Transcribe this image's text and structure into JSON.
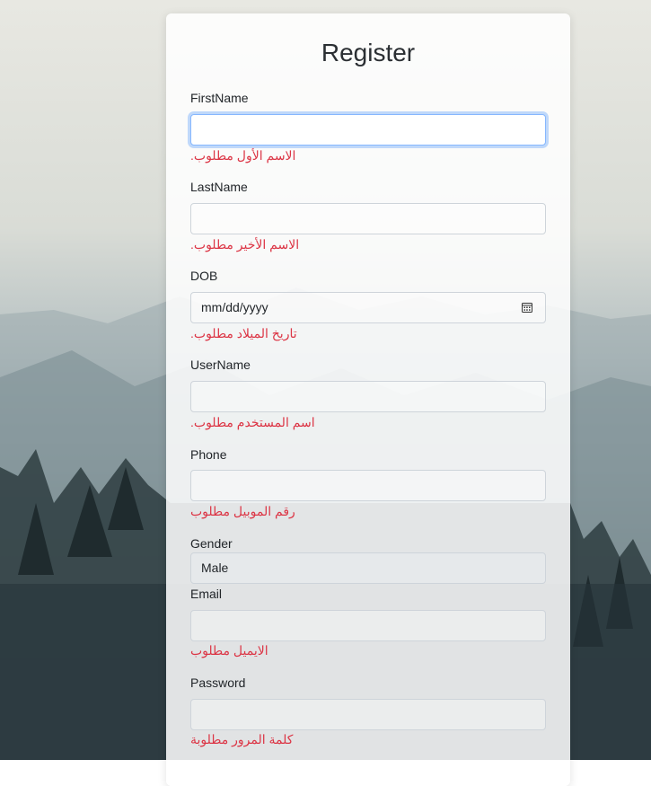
{
  "form": {
    "title": "Register",
    "fields": [
      {
        "label": "FirstName",
        "value": "",
        "error": ".الاسم الأول مطلوب"
      },
      {
        "label": "LastName",
        "value": "",
        "error": ".الاسم الأخير مطلوب"
      },
      {
        "label": "DOB",
        "value": "mm/dd/yyyy",
        "error": ".تاريخ الميلاد مطلوب"
      },
      {
        "label": "UserName",
        "value": "",
        "error": ".اسم المستخدم مطلوب"
      },
      {
        "label": "Phone",
        "value": "",
        "error": "رقم الموبيل مطلوب"
      },
      {
        "label": "Gender",
        "value": "Male"
      },
      {
        "label": "Email",
        "value": "",
        "error": "الايميل مطلوب"
      },
      {
        "label": "Password",
        "value": "",
        "error": "كلمة المرور مطلوبة"
      }
    ]
  },
  "colors": {
    "error": "#dc3545",
    "focus_border": "#86b7fe"
  },
  "icons": {
    "dob_picker": "calendar-icon"
  }
}
